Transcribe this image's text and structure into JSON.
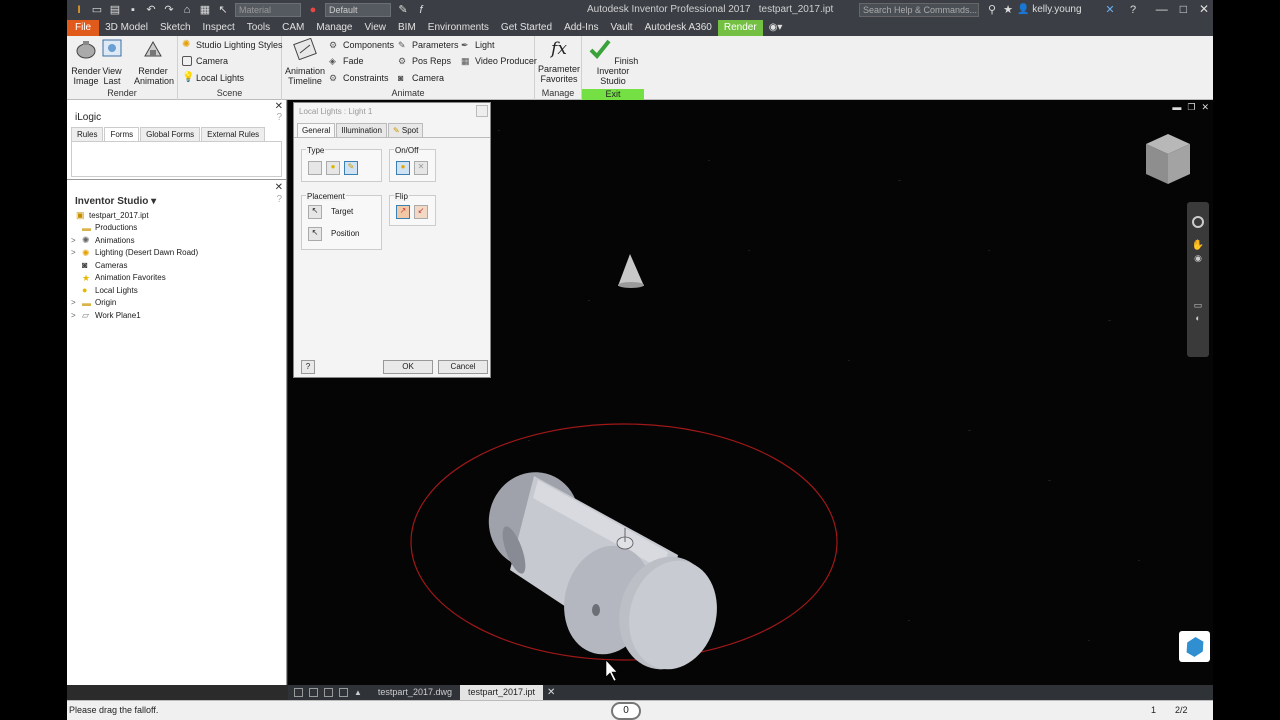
{
  "window": {
    "title": "Autodesk Inventor Professional 2017",
    "doc_name": "testpart_2017.ipt",
    "material_select": "Material",
    "appearance_select": "Default",
    "search_placeholder": "Search Help & Commands...",
    "user": "kelly.young"
  },
  "menu": [
    "File",
    "3D Model",
    "Sketch",
    "Inspect",
    "Tools",
    "CAM",
    "Manage",
    "View",
    "BIM",
    "Environments",
    "Get Started",
    "Add-Ins",
    "Vault",
    "Autodesk A360",
    "Render"
  ],
  "ribbon": {
    "render_group": {
      "label": "Render",
      "render_image": "Render\nImage",
      "view_last": "View\nLast",
      "render_animation": "Render\nAnimation"
    },
    "scene_group": {
      "label": "Scene",
      "items": [
        "Studio Lighting Styles",
        "Camera",
        "Local Lights"
      ]
    },
    "animate_group": {
      "label": "Animate",
      "animation_timeline": "Animation\nTimeline",
      "col1": [
        "Components",
        "Fade",
        "Constraints"
      ],
      "col2": [
        "Parameters",
        "Pos Reps",
        "Camera"
      ],
      "col3": [
        "Light",
        "Video Producer"
      ]
    },
    "manage_group": {
      "label": "Manage",
      "parameter_favorites": "Parameter\nFavorites"
    },
    "exit_group": {
      "label": "Exit",
      "finish": "Finish\nInventor Studio"
    }
  },
  "ilogic": {
    "title": "iLogic",
    "tabs": [
      "Rules",
      "Forms",
      "Global Forms",
      "External Rules"
    ],
    "selected_tab": "Forms"
  },
  "browser": {
    "title": "Inventor Studio",
    "items": [
      {
        "label": "testpart_2017.ipt",
        "icon": "part-icon",
        "expand": ""
      },
      {
        "label": "Productions",
        "icon": "folder-icon",
        "expand": ""
      },
      {
        "label": "Animations",
        "icon": "animation-icon",
        "expand": ">"
      },
      {
        "label": "Lighting (Desert Dawn Road)",
        "icon": "lighting-icon",
        "expand": ">"
      },
      {
        "label": "Cameras",
        "icon": "camera-icon",
        "expand": ""
      },
      {
        "label": "Animation Favorites",
        "icon": "star-icon",
        "expand": ""
      },
      {
        "label": "Local Lights",
        "icon": "bulb-icon",
        "expand": ""
      },
      {
        "label": "Origin",
        "icon": "folder-icon",
        "expand": ">"
      },
      {
        "label": "Work Plane1",
        "icon": "workplane-icon",
        "expand": ">"
      }
    ]
  },
  "dialog": {
    "title": "Local Lights : Light 1",
    "tabs": [
      "General",
      "Illumination",
      "Spot"
    ],
    "selected_tab": "General",
    "type_label": "Type",
    "onoff_label": "On/Off",
    "placement_label": "Placement",
    "target_label": "Target",
    "position_label": "Position",
    "flip_label": "Flip",
    "ok": "OK",
    "cancel": "Cancel"
  },
  "doc_tabs": [
    "testpart_2017.dwg",
    "testpart_2017.ipt"
  ],
  "status": {
    "message": "Please drag the falloff.",
    "count": "1",
    "pages": "2/2"
  },
  "colors": {
    "file_menu": "#e05a1c",
    "render_tab": "#74c043",
    "falloff_ellipse": "#a01818",
    "exit_bar": "#74e043"
  }
}
